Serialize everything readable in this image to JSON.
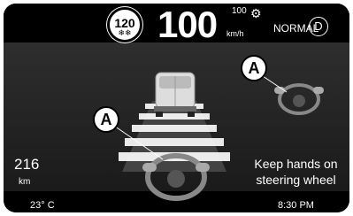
{
  "cluster": {
    "speed_limit": "120",
    "speed_limit_sub": "❄❄",
    "speed": "100",
    "speed_unit": "km/h",
    "cruise_speed": "100",
    "drive_mode": "NORMAL",
    "gear": "D"
  },
  "alert": {
    "callout_label": "A",
    "message_line1": "Keep hands on",
    "message_line2": "steering wheel"
  },
  "status": {
    "range_value": "216",
    "range_unit": "km",
    "outside_temp": "23° C",
    "time": "8:30 PM"
  },
  "icons": [
    "snowflake-icon",
    "cruise-control-icon",
    "van-icon",
    "steering-wheel-icon",
    "hands-icon"
  ]
}
